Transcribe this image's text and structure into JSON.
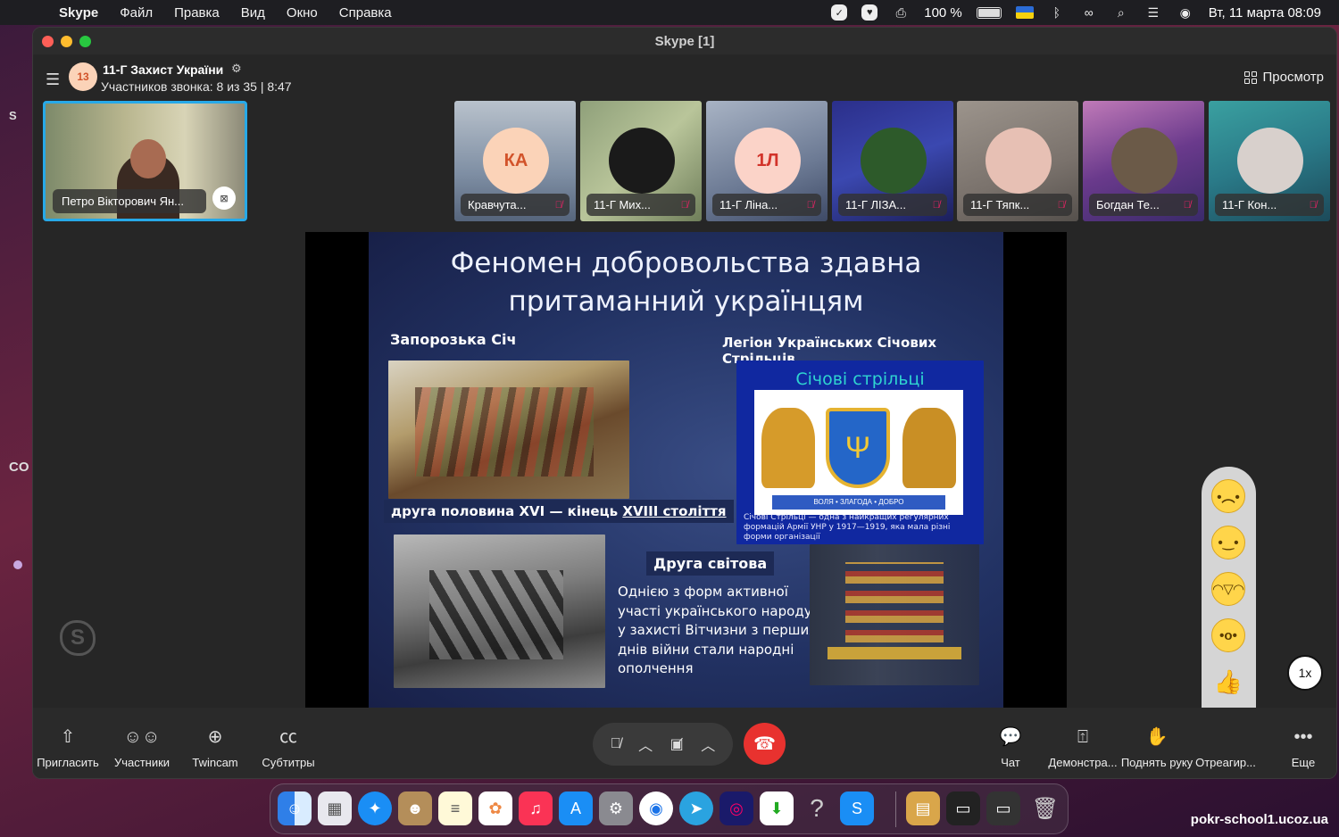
{
  "menubar": {
    "app": "Skype",
    "items": [
      "Файл",
      "Правка",
      "Вид",
      "Окно",
      "Справка"
    ],
    "battery": "100 %",
    "datetime": "Вт, 11 марта  08:09"
  },
  "desktop": {
    "text_s": "S",
    "text_co": "CO"
  },
  "window": {
    "title": "Skype [1]"
  },
  "call": {
    "avatar_badge": "13",
    "title": "11-Г Захист України",
    "subtitle": "Участников звонка: 8 из 35 | 8:47",
    "view_label": "Просмотр"
  },
  "self_tile": {
    "name": "Петро Вікторович Ян..."
  },
  "participants": [
    {
      "name": "Кравчута...",
      "initials": "КА",
      "avatar_color": "#fbd3b8"
    },
    {
      "name": "11-Г Мих...",
      "initials": "",
      "avatar_color": "#222"
    },
    {
      "name": "11-Г Ліна...",
      "initials": "1Л",
      "avatar_color": "#fbd3c8"
    },
    {
      "name": "11-Г ЛІЗА...",
      "initials": "",
      "avatar_color": "#2d5a2a"
    },
    {
      "name": "11-Г Тяпк...",
      "initials": "",
      "avatar_color": "#e7c0b4"
    },
    {
      "name": "Богдан Те...",
      "initials": "",
      "avatar_color": "#6b5a48"
    },
    {
      "name": "11-Г Кон...",
      "initials": "",
      "avatar_color": "#d8d0cc"
    }
  ],
  "slide": {
    "title_line1": "Феномен добровольства здавна",
    "title_line2": "притаманний українцям",
    "left_heading": "Запорозька Січ",
    "right_heading": "Легіон Українських Січових Стрільців",
    "caption_prefix": "друга половина XVI — кінець ",
    "caption_underlined": "XVIII століття",
    "lsu_title": "Січові стрільці",
    "lsu_banner": "ВОЛЯ • ЗЛАГОДА • ДОБРО",
    "lsu_caption": "Січові Стрільці — одна з найкращих регулярних формацій Армії УНР у 1917—1919, яка мала різні форми організації",
    "ww2_heading": "Друга світова",
    "ww2_text": "Однією з форм активної участі українського народу у захисті Вітчизни з перших днів війни стали народні ополчення"
  },
  "speed": "1x",
  "toolbar": {
    "invite": "Пригласить",
    "participants": "Участники",
    "twincam": "Twincam",
    "subtitles": "Субтитры",
    "chat": "Чат",
    "share": "Демонстра...",
    "raise_hand": "Поднять руку",
    "react": "Отреагир...",
    "more": "Еще"
  },
  "watermark_url": "pokr-school1.ucoz.ua"
}
